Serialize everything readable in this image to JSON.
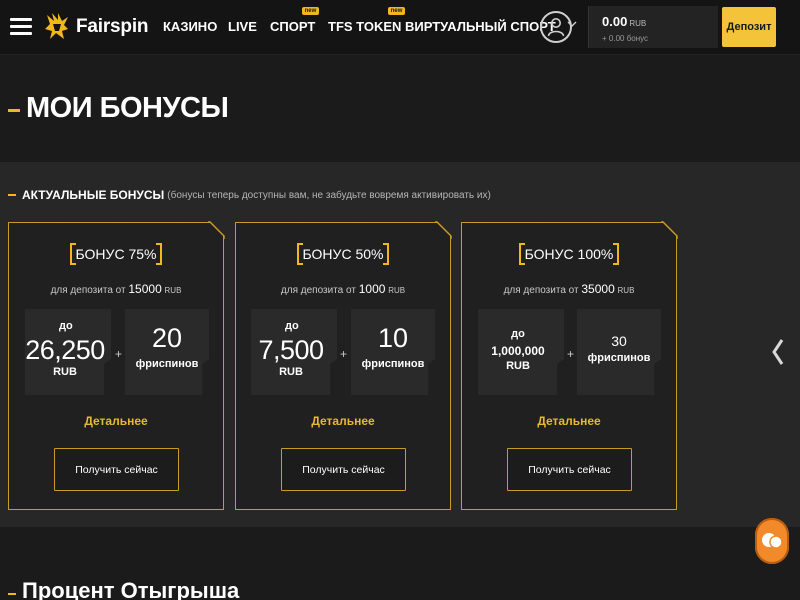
{
  "header": {
    "brand": "Fairspin",
    "nav": [
      {
        "label": "КАЗИНО",
        "badge": ""
      },
      {
        "label": "LIVE",
        "badge": ""
      },
      {
        "label": "СПОРТ",
        "badge": "new"
      },
      {
        "label": "TFS TOKEN",
        "badge": "new"
      },
      {
        "label": "ВИРТУАЛЬНЫЙ СПОРТ",
        "badge": ""
      }
    ],
    "balance": "0.00",
    "balance_currency": "RUB",
    "bonus_balance": "+ 0.00 бонус",
    "deposit_label": "Депозит"
  },
  "page_title": "МОИ БОНУСЫ",
  "section": {
    "title": "АКТУАЛЬНЫЕ БОНУСЫ",
    "note": "(бонусы теперь доступны вам, не забудьте вовремя активировать их)"
  },
  "cards": [
    {
      "title": "БОНУС 75%",
      "sub_prefix": "для депозита от",
      "min_deposit": "15000",
      "currency": "RUB",
      "amount_prefix": "до",
      "amount": "26,250",
      "amount_currency": "RUB",
      "free_count": "20",
      "free_label": "фриспинов",
      "details": "Детальнее",
      "button": "Получить сейчас"
    },
    {
      "title": "БОНУС 50%",
      "sub_prefix": "для депозита от",
      "min_deposit": "1000",
      "currency": "RUB",
      "amount_prefix": "до",
      "amount": "7,500",
      "amount_currency": "RUB",
      "free_count": "10",
      "free_label": "фриспинов",
      "details": "Детальнее",
      "button": "Получить сейчас"
    },
    {
      "title": "БОНУС 100%",
      "sub_prefix": "для депозита от",
      "min_deposit": "35000",
      "currency": "RUB",
      "amount_prefix": "до",
      "amount": "1,000,000",
      "amount_currency": "RUB",
      "free_count": "30",
      "free_label": "фриспинов",
      "details": "Детальнее",
      "button": "Получить сейчас"
    }
  ],
  "plus_sign": "+",
  "bottom_title": "Процент Отыгрыша",
  "colors": {
    "accent": "#f2b71d",
    "card_border": "#c99a25",
    "deposit_button": "#f4c339",
    "chat_button": "#f28a2a"
  },
  "icons": [
    "menu-icon",
    "logo-icon",
    "user-icon",
    "chevron-down-icon",
    "chevron-left-icon",
    "chat-icon"
  ]
}
